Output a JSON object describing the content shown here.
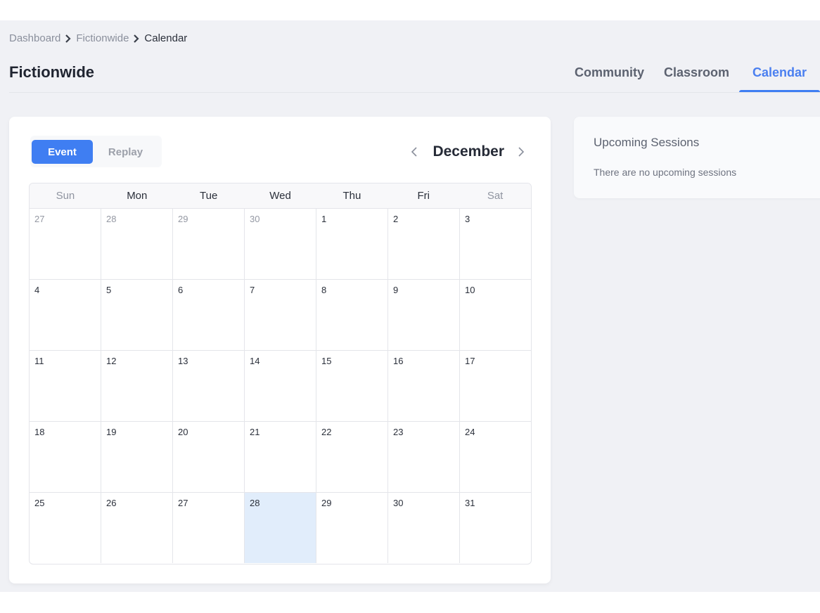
{
  "breadcrumb": [
    {
      "label": "Dashboard",
      "current": false
    },
    {
      "label": "Fictionwide",
      "current": false
    },
    {
      "label": "Calendar",
      "current": true
    }
  ],
  "page_title": "Fictionwide",
  "tabs": [
    {
      "label": "Community",
      "active": false
    },
    {
      "label": "Classroom",
      "active": false
    },
    {
      "label": "Calendar",
      "active": true
    }
  ],
  "calendar": {
    "toggle": {
      "event_label": "Event",
      "replay_label": "Replay",
      "selected": "Event"
    },
    "month": "December",
    "weekdays": [
      "Sun",
      "Mon",
      "Tue",
      "Wed",
      "Thu",
      "Fri",
      "Sat"
    ],
    "weeks": [
      [
        {
          "d": "27",
          "other": true
        },
        {
          "d": "28",
          "other": true
        },
        {
          "d": "29",
          "other": true
        },
        {
          "d": "30",
          "other": true
        },
        {
          "d": "1"
        },
        {
          "d": "2"
        },
        {
          "d": "3"
        }
      ],
      [
        {
          "d": "4"
        },
        {
          "d": "5"
        },
        {
          "d": "6"
        },
        {
          "d": "7"
        },
        {
          "d": "8"
        },
        {
          "d": "9"
        },
        {
          "d": "10"
        }
      ],
      [
        {
          "d": "11"
        },
        {
          "d": "12"
        },
        {
          "d": "13"
        },
        {
          "d": "14"
        },
        {
          "d": "15"
        },
        {
          "d": "16"
        },
        {
          "d": "17"
        }
      ],
      [
        {
          "d": "18"
        },
        {
          "d": "19"
        },
        {
          "d": "20"
        },
        {
          "d": "21"
        },
        {
          "d": "22"
        },
        {
          "d": "23"
        },
        {
          "d": "24"
        }
      ],
      [
        {
          "d": "25"
        },
        {
          "d": "26"
        },
        {
          "d": "27"
        },
        {
          "d": "28",
          "today": true
        },
        {
          "d": "29"
        },
        {
          "d": "30"
        },
        {
          "d": "31"
        }
      ]
    ],
    "today": "28"
  },
  "sessions": {
    "title": "Upcoming Sessions",
    "empty_text": "There are no upcoming sessions"
  },
  "colors": {
    "accent": "#3f7ef2",
    "today_bg": "#e1edfb",
    "page_bg": "#f0f1f5"
  }
}
